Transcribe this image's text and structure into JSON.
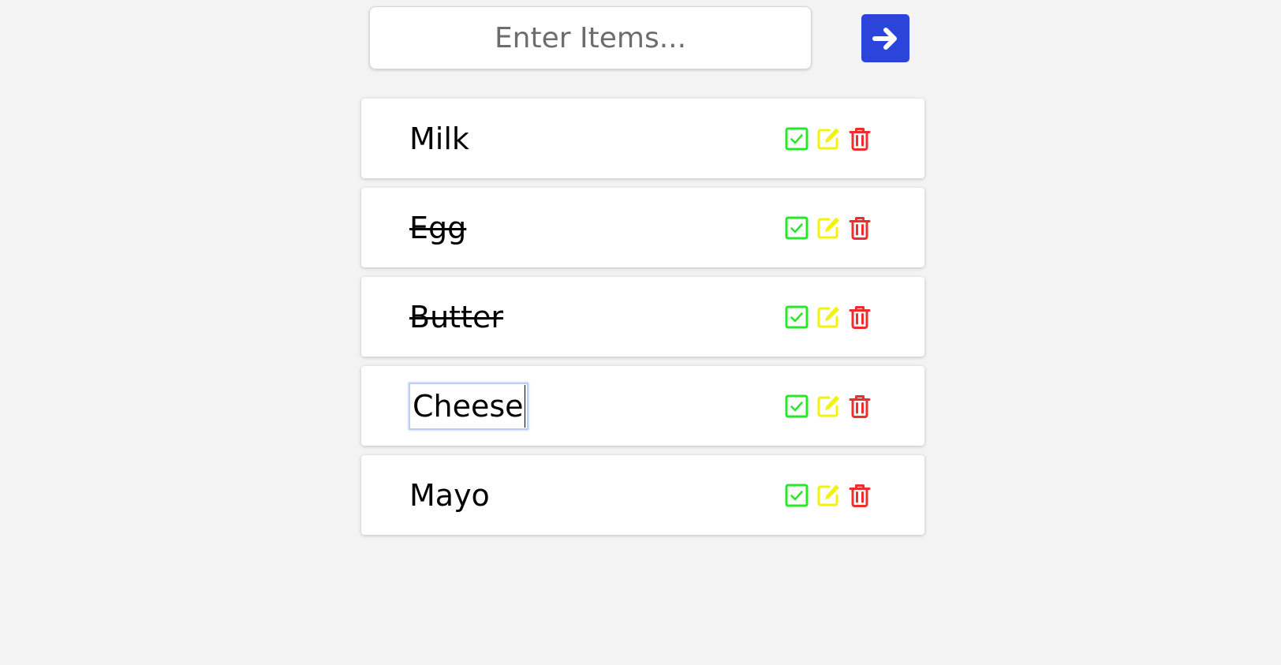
{
  "input": {
    "placeholder": "Enter Items...",
    "value": ""
  },
  "submit_button": {
    "icon": "arrow-right-icon",
    "color": "#2b45db"
  },
  "colors": {
    "check": "#26e826",
    "edit": "#f2f20a",
    "delete": "#ee2e2e"
  },
  "items": [
    {
      "label": "Milk",
      "done": false,
      "editing": false
    },
    {
      "label": "Egg",
      "done": true,
      "editing": false
    },
    {
      "label": "Butter",
      "done": true,
      "editing": false
    },
    {
      "label": "Cheese",
      "done": false,
      "editing": true
    },
    {
      "label": "Mayo",
      "done": false,
      "editing": false
    }
  ],
  "icons": {
    "check": "check-square-icon",
    "edit": "edit-icon",
    "delete": "trash-icon"
  }
}
